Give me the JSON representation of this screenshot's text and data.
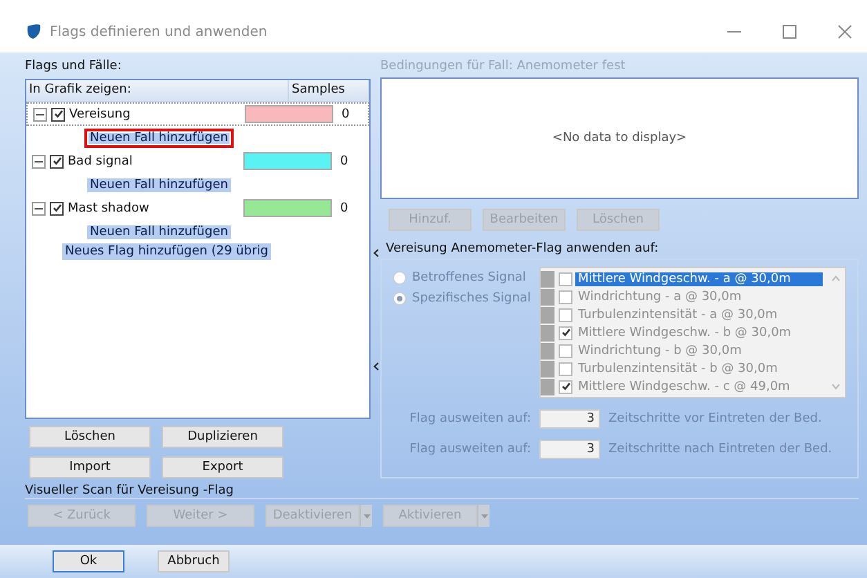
{
  "window": {
    "title": "Flags definieren und anwenden"
  },
  "left": {
    "heading": "Flags und Fälle:",
    "tree_columns": [
      "In Grafik zeigen:",
      "Samples"
    ],
    "flags": [
      {
        "name": "Vereisung",
        "checked": true,
        "expanded": true,
        "color": "#f8b8bc",
        "samples": "0",
        "selected": true,
        "children": [
          {
            "label": "Neuen Fall hinzufügen",
            "highlighted": true
          }
        ]
      },
      {
        "name": "Bad signal",
        "checked": true,
        "expanded": true,
        "color": "#5af2f2",
        "samples": "0",
        "selected": false,
        "children": [
          {
            "label": "Neuen Fall hinzufügen",
            "highlighted": false
          }
        ]
      },
      {
        "name": "Mast shadow",
        "checked": true,
        "expanded": true,
        "color": "#96e896",
        "samples": "0",
        "selected": false,
        "children": [
          {
            "label": "Neuen Fall hinzufügen",
            "highlighted": false
          }
        ]
      }
    ],
    "add_flag": "Neues Flag hinzufügen (29 übrig",
    "buttons": [
      [
        "Löschen",
        "Duplizieren"
      ],
      [
        "Import",
        "Export"
      ]
    ]
  },
  "right": {
    "conditions_title": "Bedingungen für Fall: Anemometer fest",
    "empty_text": "<No data to display>",
    "condition_buttons": [
      {
        "label": "Hinzuf.",
        "disabled": true
      },
      {
        "label": "Bearbeiten",
        "disabled": true
      },
      {
        "label": "Löschen",
        "disabled": true
      }
    ],
    "apply_title": "Vereisung Anemometer-Flag anwenden auf:",
    "radios": [
      {
        "label": "Betroffenes Signal",
        "selected": false
      },
      {
        "label": "Spezifisches Signal",
        "selected": true
      }
    ],
    "signals": [
      {
        "label": "Mittlere Windgeschw. - a @ 30,0m",
        "checked": false,
        "selected": true
      },
      {
        "label": "Windrichtung - a @ 30,0m",
        "checked": false,
        "selected": false
      },
      {
        "label": "Turbulenzintensität - a @ 30,0m",
        "checked": false,
        "selected": false
      },
      {
        "label": "Mittlere Windgeschw. - b @ 30,0m",
        "checked": true,
        "selected": false
      },
      {
        "label": "Windrichtung - b @ 30,0m",
        "checked": false,
        "selected": false
      },
      {
        "label": "Turbulenzintensität - b @ 30,0m",
        "checked": false,
        "selected": false
      },
      {
        "label": "Mittlere Windgeschw. - c @ 49,0m",
        "checked": true,
        "selected": false
      }
    ],
    "extend": [
      {
        "label": "Flag ausweiten auf:",
        "value": "3",
        "suffix": "Zeitschritte vor Eintreten der Bed."
      },
      {
        "label": "Flag ausweiten auf:",
        "value": "3",
        "suffix": "Zeitschritte nach Eintreten der Bed."
      }
    ]
  },
  "scan": {
    "title": "Visueller Scan für Vereisung -Flag",
    "buttons": [
      {
        "label": "< Zurück",
        "dropdown": false
      },
      {
        "label": "Weiter >",
        "dropdown": false
      },
      {
        "label": "Deaktivieren",
        "dropdown": true
      },
      {
        "label": "Aktivieren",
        "dropdown": true
      }
    ]
  },
  "footer": {
    "buttons": [
      {
        "label": "Ok",
        "default": true
      },
      {
        "label": "Abbruch",
        "default": false
      }
    ]
  }
}
